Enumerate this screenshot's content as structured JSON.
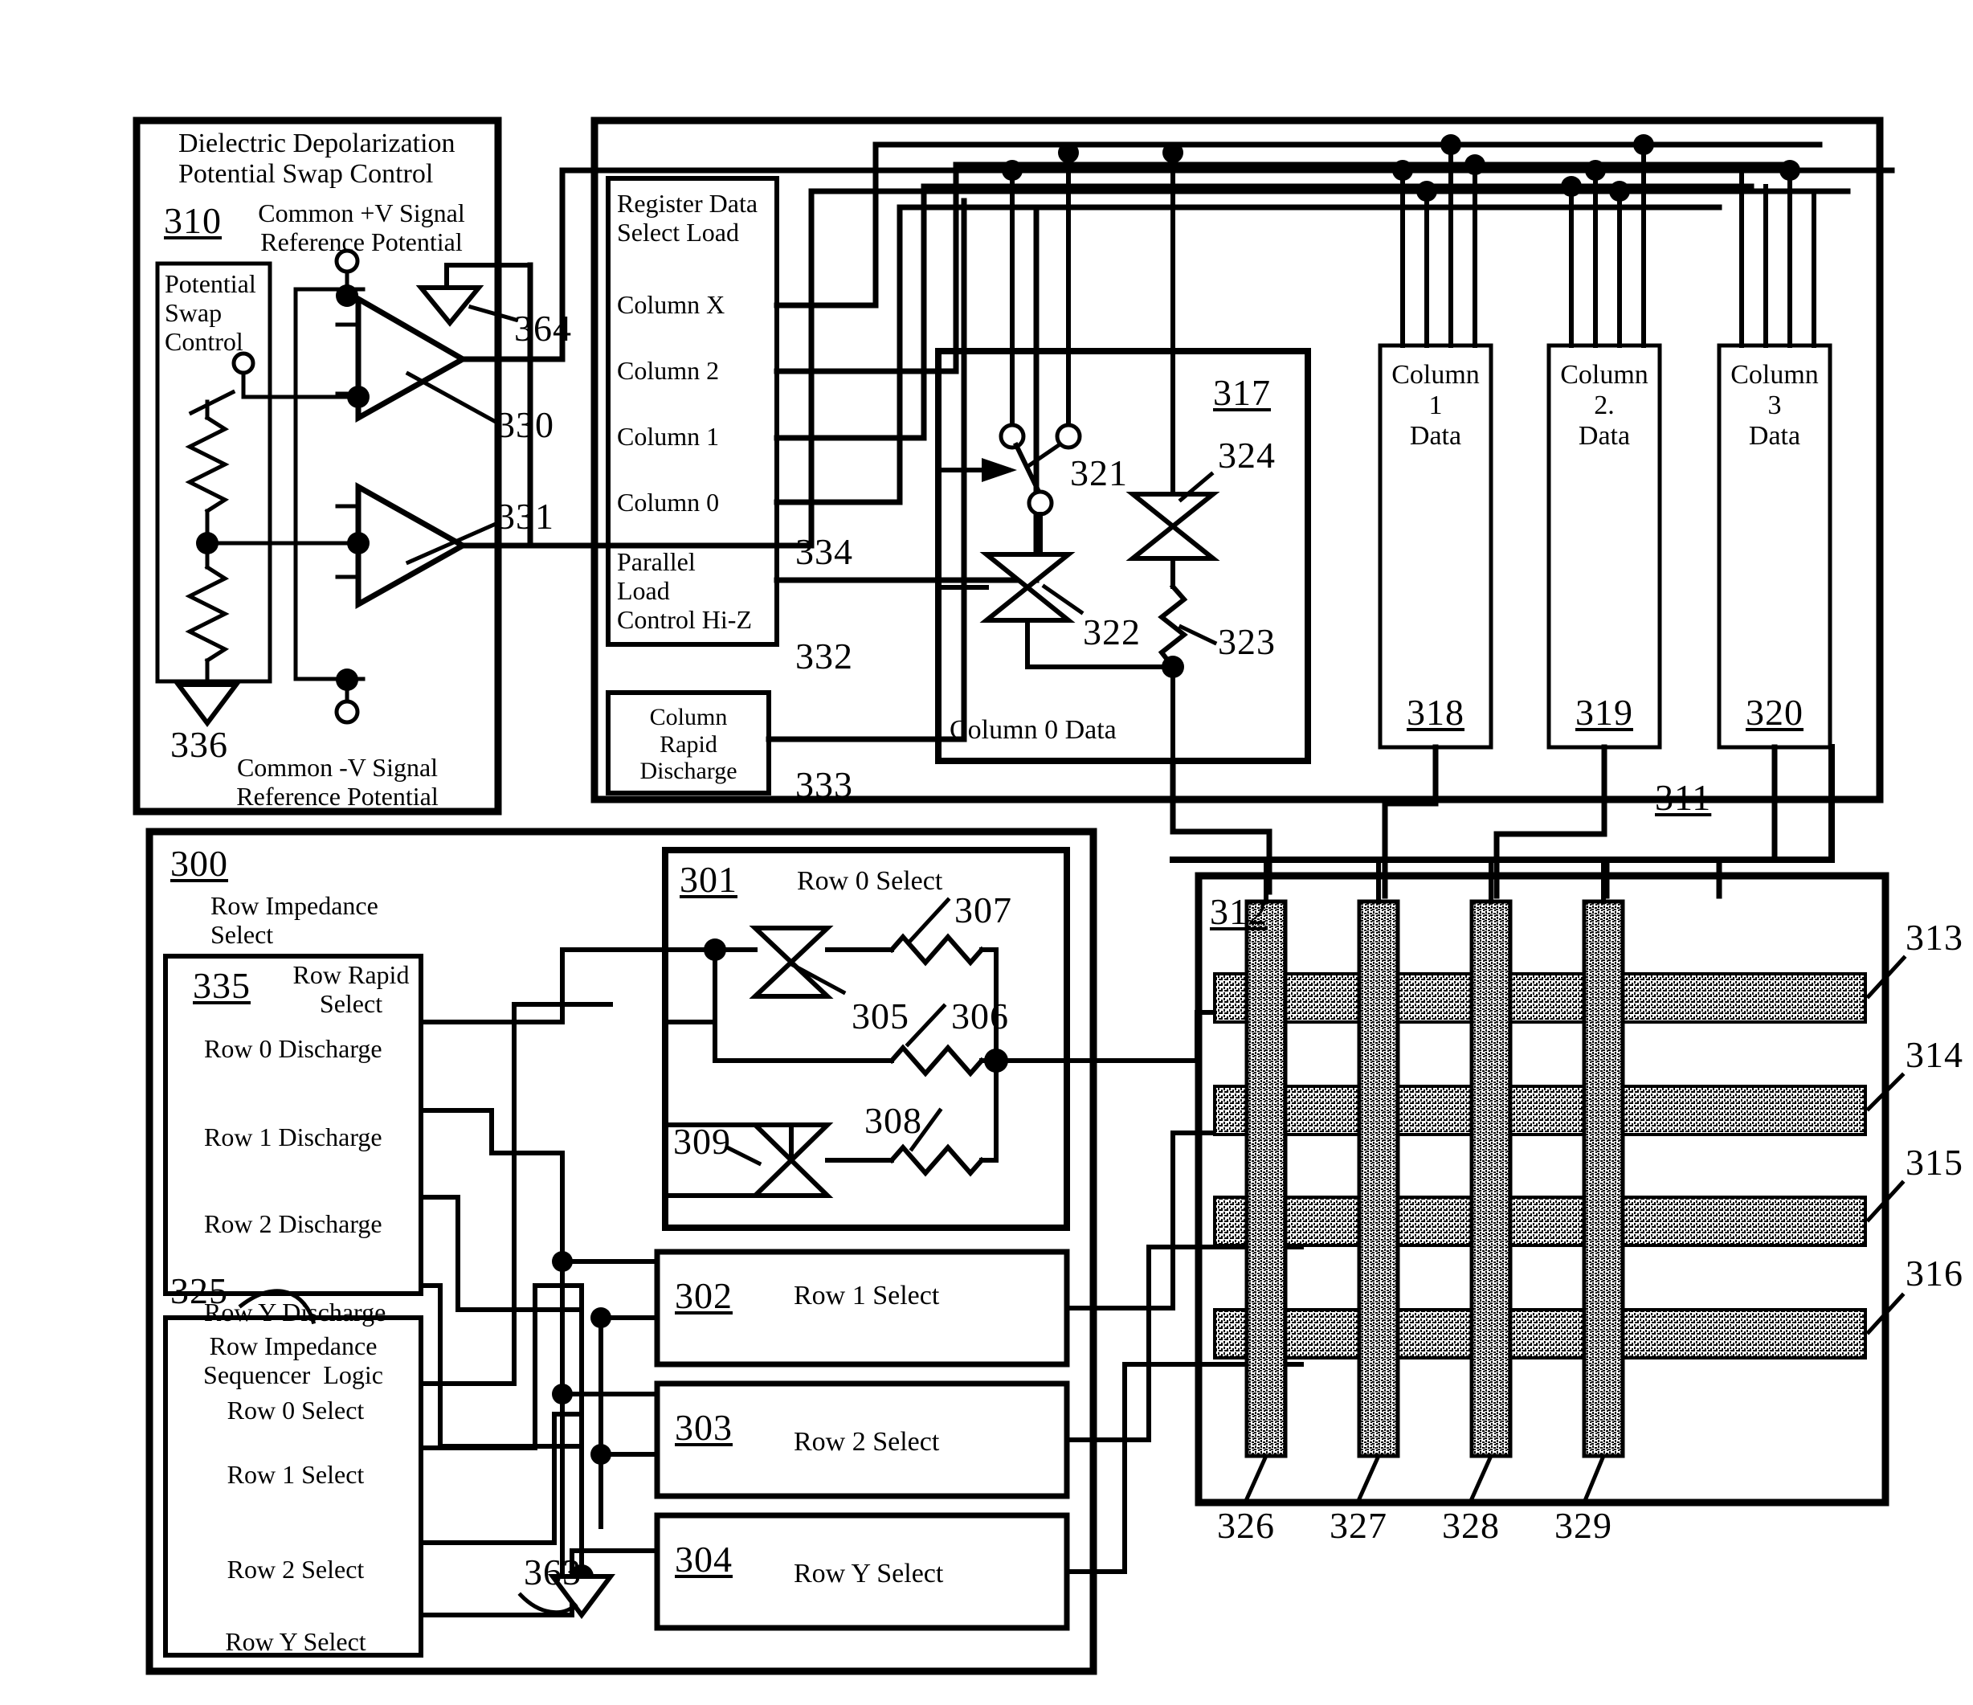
{
  "figure": {
    "type": "patent-schematic",
    "description": "Display driver circuit block diagram with dielectric depolarization potential swap control, register data select load, column data blocks, row impedance select and display matrix"
  },
  "blocks": {
    "depolarization": {
      "ref": "310",
      "title_line1": "Dielectric Depolarization",
      "title_line2": "Potential Swap Control",
      "plus_ref_line1": "Common +V Signal",
      "plus_ref_line2": "Reference Potential",
      "minus_ref_line1": "Common -V Signal",
      "minus_ref_line2": "Reference Potential",
      "swap_ctrl": {
        "ref": "336",
        "line1": "Potential",
        "line2": "Swap",
        "line3": "Control"
      },
      "opamp_top_ref": "330",
      "opamp_bottom_ref": "331",
      "ground_ref": "364"
    },
    "register": {
      "title_line1": "Register Data",
      "title_line2": "Select Load",
      "signals": [
        "Column X",
        "Column 2",
        "Column 1",
        "Column 0"
      ],
      "parallel_load": {
        "ref": "332",
        "line1": "Parallel",
        "line2": "Load",
        "line3": "Control Hi-Z"
      },
      "bus_ref": "334",
      "rapid_discharge": {
        "ref": "333",
        "line1": "Column",
        "line2": "Rapid",
        "line3": "Discharge"
      }
    },
    "column0_data": {
      "ref": "317",
      "caption": "Column 0 Data",
      "switch_ref": "321",
      "gate_lower_ref": "322",
      "resistor_ref": "323",
      "gate_upper_ref": "324"
    },
    "column_data_boxes": [
      {
        "ref_top": "318",
        "line1": "Column",
        "line2": "1",
        "line3": "Data"
      },
      {
        "ref_top": "319",
        "line1": "Column",
        "line2": "2.",
        "line3": "Data"
      },
      {
        "ref_top": "320",
        "line1": "Column",
        "line2": "3",
        "line3": "Data"
      }
    ],
    "column_bus_ref": "311",
    "row_impedance": {
      "ref": "300",
      "title_line1": "Row Impedance",
      "title_line2": "Select",
      "rapid_select": {
        "ref": "335",
        "title_line1": "Row Rapid",
        "title_line2": "Select",
        "signals": [
          "Row 0 Discharge",
          "Row 1 Discharge",
          "Row 2 Discharge",
          "Row Y Discharge"
        ]
      },
      "sequencer": {
        "ref": "325",
        "title_line1": "Row Impedance",
        "title_line2": "Sequencer  Logic",
        "signals": [
          "Row 0 Select",
          "Row 1 Select",
          "Row 2 Select",
          "Row Y Select"
        ]
      },
      "ground_ref": "363"
    },
    "row0_select": {
      "ref": "301",
      "caption": "Row 0 Select",
      "gate_top_ref": "305",
      "gate_bottom_ref": "309",
      "res_top_ref": "307",
      "res_mid_ref": "306",
      "res_bottom_ref": "308"
    },
    "row_select_boxes": [
      {
        "ref": "302",
        "label": "Row 1 Select"
      },
      {
        "ref": "303",
        "label": "Row 2 Select"
      },
      {
        "ref": "304",
        "label": "Row Y Select"
      }
    ],
    "matrix": {
      "ref": "312",
      "row_refs": [
        "313",
        "314",
        "315",
        "316"
      ],
      "column_refs": [
        "326",
        "327",
        "328",
        "329"
      ]
    }
  }
}
